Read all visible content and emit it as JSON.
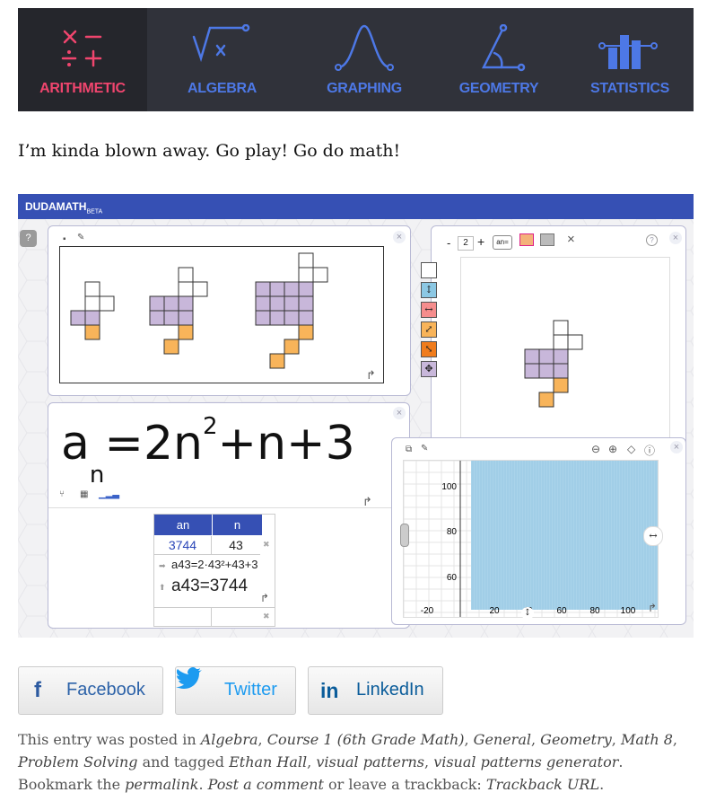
{
  "nav": {
    "tabs": [
      {
        "label": "ARITHMETIC",
        "icon": "arithmetic-icon",
        "active": true
      },
      {
        "label": "ALGEBRA",
        "icon": "sqrt-icon",
        "active": false
      },
      {
        "label": "GRAPHING",
        "icon": "bell-curve-icon",
        "active": false
      },
      {
        "label": "GEOMETRY",
        "icon": "angle-icon",
        "active": false
      },
      {
        "label": "STATISTICS",
        "icon": "bar-chart-icon",
        "active": false
      }
    ],
    "colors": {
      "bg": "#30323a",
      "active_bg": "#25262c",
      "accent": "#f0456e",
      "tab_color": "#4d78e6"
    }
  },
  "intro_text": "I’m kinda blown away. Go play! Go do math!",
  "app": {
    "brand": "DUDAMATH",
    "brand_tag": "BETA",
    "help": "?",
    "close": "×",
    "stepper_minus": "-",
    "stepper_value": "2",
    "stepper_plus": "+",
    "an_button": "an=",
    "formula": {
      "a": "a",
      "sub": "n",
      "eq": "=",
      "coef": "2n",
      "exp": "2",
      "rest": "+n+3"
    },
    "table": {
      "headers": [
        "an",
        "n"
      ],
      "row": {
        "an": "3744",
        "n": "43"
      },
      "calc_line": "a43=2·43²+43+3",
      "calc_result": "a43=3744"
    },
    "graph": {
      "y_ticks": [
        "100",
        "80",
        "60"
      ],
      "x_ticks": [
        "-20",
        "20",
        "40",
        "60",
        "80",
        "100"
      ]
    },
    "colors": {
      "topbar": "#3650b4",
      "pattern_fill": "#c8b7da",
      "new_fill": "#f8b45a",
      "graph_fill": "#a9d3ea"
    }
  },
  "share": {
    "facebook": "Facebook",
    "twitter": "Twitter",
    "linkedin": "LinkedIn"
  },
  "footer": {
    "p1": "This entry was posted in",
    "cats": [
      "Algebra",
      "Course 1 (6th Grade Math)",
      "General",
      "Geometry",
      "Math 8",
      "Problem Solving"
    ],
    "tagged": "and tagged",
    "tags": [
      "Ethan Hall",
      "visual patterns",
      "visual patterns generator"
    ],
    "bookmark": "Bookmark the",
    "permalink": "permalink",
    "post_comment": "Post a comment",
    "trackback_text": "or leave a trackback:",
    "trackback": "Trackback URL"
  }
}
